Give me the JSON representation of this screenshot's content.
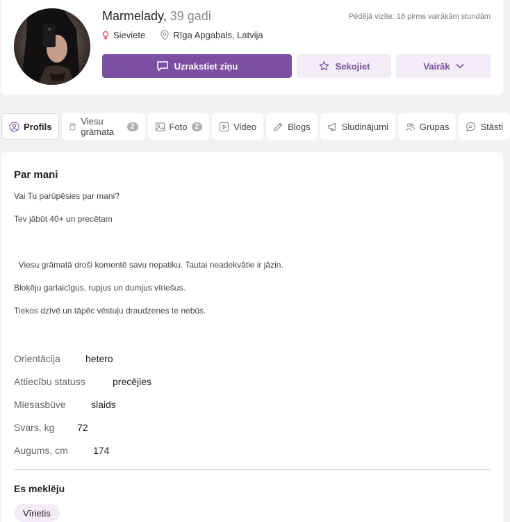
{
  "profile": {
    "name": "Marmelady,",
    "age": "39 gadi",
    "last_visit": "Pēdējā vizīte: 16 pirms vairākām stundām",
    "gender": "Sieviete",
    "location": "Rīga Apgabals, Latvija"
  },
  "actions": {
    "message": "Uzrakstiet ziņu",
    "follow": "Sekojiet",
    "more": "Vairāk"
  },
  "tabs": [
    {
      "label": "Profils",
      "icon": "user-icon"
    },
    {
      "label": "Viesu grāmata",
      "badge": "2",
      "icon": "book-icon"
    },
    {
      "label": "Foto",
      "badge": "2",
      "icon": "image-icon"
    },
    {
      "label": "Video",
      "icon": "play-icon"
    },
    {
      "label": "Blogs",
      "icon": "pencil-icon"
    },
    {
      "label": "Sludinājumi",
      "icon": "megaphone-icon"
    },
    {
      "label": "Grupas",
      "icon": "group-icon"
    },
    {
      "label": "Stāsti",
      "icon": "chat-icon"
    }
  ],
  "about": {
    "title": "Par mani",
    "lines": [
      "Vai Tu parūpēsies par mani?",
      "Tev jābūt 40+ un precētam",
      "",
      "  Viesu grāmatā droši komentē savu nepatiku. Tautai neadekvātie ir jāzin.",
      "Bloķēju garlaicīgus, rupjus un dumjus vīriešus.",
      "Tiekos dzīvē un tāpēc vēstuļu draudzenes te nebūs."
    ]
  },
  "details": [
    {
      "key": "Orientācija",
      "value": "hetero"
    },
    {
      "key": "Attiecību statuss",
      "value": "precējies"
    },
    {
      "key": "Miesasbūve",
      "value": "slaids"
    },
    {
      "key": "Svars, kg",
      "value": "72"
    },
    {
      "key": "Augums, cm",
      "value": "174"
    }
  ],
  "seeking": {
    "title": "Es meklēju",
    "chip": "Vīrietis"
  },
  "colors": {
    "accent": "#7b4fa1",
    "accent_light": "#f1ecf6",
    "female_icon": "#e05a6a"
  }
}
